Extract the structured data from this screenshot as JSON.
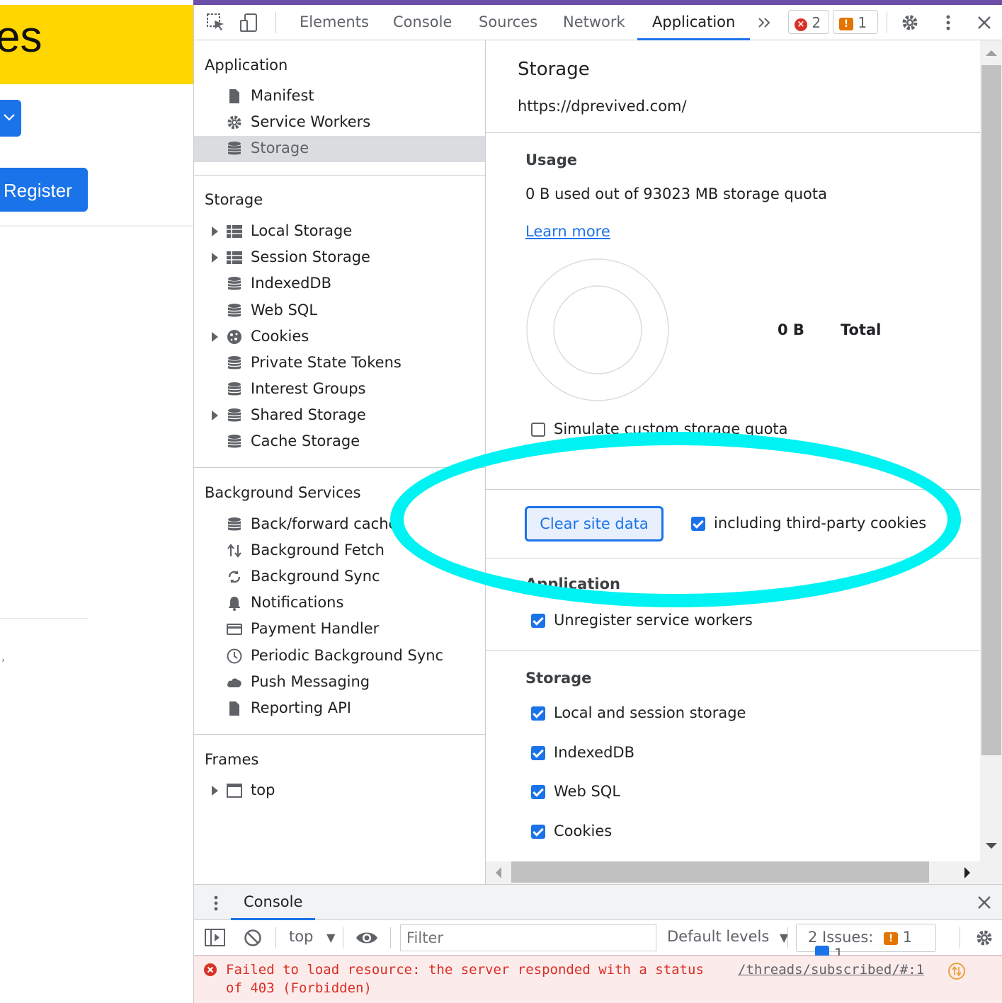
{
  "page": {
    "heading_fragment": "es",
    "register_label": "Register"
  },
  "toolbar": {
    "tabs": [
      "Elements",
      "Console",
      "Sources",
      "Network",
      "Application"
    ],
    "active_tab": "Application",
    "error_count": "2",
    "warning_count": "1"
  },
  "sidebar": {
    "application_title": "Application",
    "application_items": [
      "Manifest",
      "Service Workers",
      "Storage"
    ],
    "storage_title": "Storage",
    "storage_items": [
      "Local Storage",
      "Session Storage",
      "IndexedDB",
      "Web SQL",
      "Cookies",
      "Private State Tokens",
      "Interest Groups",
      "Shared Storage",
      "Cache Storage"
    ],
    "background_title": "Background Services",
    "background_items": [
      "Back/forward cache",
      "Background Fetch",
      "Background Sync",
      "Notifications",
      "Payment Handler",
      "Periodic Background Sync",
      "Push Messaging",
      "Reporting API"
    ],
    "frames_title": "Frames",
    "frames_items": [
      "top"
    ]
  },
  "main": {
    "title": "Storage",
    "origin": "https://dprevived.com/",
    "usage_heading": "Usage",
    "usage_text": "0 B used out of 93023 MB storage quota",
    "learn_more": "Learn more",
    "total_value": "0 B",
    "total_label": "Total",
    "simulate_label": "Simulate custom storage quota",
    "clear_button": "Clear site data",
    "third_party_label": "including third-party cookies",
    "application_heading": "Application",
    "unregister_label": "Unregister service workers",
    "storage_heading": "Storage",
    "storage_options": [
      "Local and session storage",
      "IndexedDB",
      "Web SQL",
      "Cookies"
    ]
  },
  "drawer": {
    "tab_label": "Console",
    "context": "top",
    "filter_placeholder": "Filter",
    "levels": "Default levels",
    "issues_label": "2 Issues:",
    "issues_warn": "1",
    "issues_info": "1",
    "error_message": "Failed to load resource: the server responded with a status of 403 (Forbidden)",
    "error_source": "/threads/subscribed/#:1"
  },
  "colors": {
    "accent": "#1a73e8",
    "highlight_ring": "#00f3f3",
    "banner": "#ffd600",
    "error": "#d93025"
  }
}
